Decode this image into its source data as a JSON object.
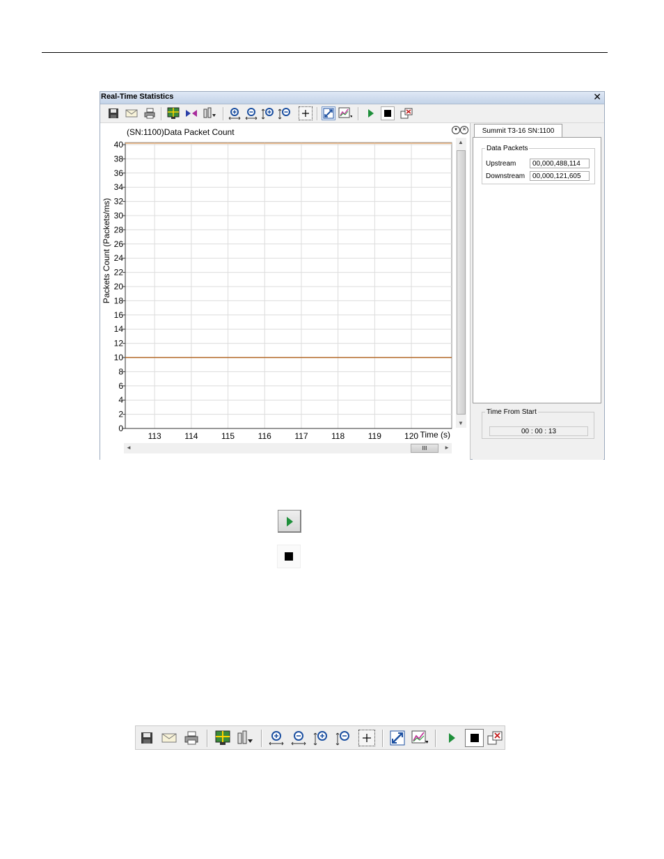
{
  "window": {
    "title": "Real-Time Statistics",
    "close_glyph": "✕"
  },
  "toolbar": {
    "buttons": [
      {
        "name": "save-icon"
      },
      {
        "name": "email-icon"
      },
      {
        "name": "print-icon"
      },
      {
        "name": "chart-grid-icon"
      },
      {
        "name": "compare-icon"
      },
      {
        "name": "properties-icon"
      },
      {
        "name": "zoom-in-horizontal-icon"
      },
      {
        "name": "zoom-out-horizontal-icon"
      },
      {
        "name": "zoom-in-vertical-icon"
      },
      {
        "name": "zoom-out-vertical-icon"
      },
      {
        "name": "zoom-box-icon"
      },
      {
        "name": "autoscale-icon"
      },
      {
        "name": "chart-options-icon"
      },
      {
        "name": "play-icon"
      },
      {
        "name": "stop-icon"
      },
      {
        "name": "detach-icon"
      }
    ]
  },
  "chart_data": {
    "type": "line",
    "title": "(SN:1100)Data Packet Count",
    "xlabel": "Time (s)",
    "ylabel": "Packets Count (Packets/ms)",
    "x_ticks": [
      113,
      114,
      115,
      116,
      117,
      118,
      119,
      120
    ],
    "y_ticks": [
      0,
      2,
      4,
      6,
      8,
      10,
      12,
      14,
      16,
      18,
      20,
      22,
      24,
      26,
      28,
      30,
      32,
      34,
      36,
      38,
      40
    ],
    "xlim": [
      112.2,
      121.1
    ],
    "ylim": [
      0,
      40
    ],
    "grid": true,
    "series": [
      {
        "color": "#e8b07a",
        "x": [
          112.2,
          121.1
        ],
        "y": [
          40.5,
          40.5
        ]
      },
      {
        "color": "#b36a2a",
        "x": [
          112.2,
          121.1
        ],
        "y": [
          10,
          10
        ]
      }
    ]
  },
  "side_panel": {
    "tab_label": "Summit T3-16 SN:1100",
    "group_title": "Data Packets",
    "upstream_label": "Upstream",
    "upstream_value": "00,000,488,114",
    "downstream_label": "Downstream",
    "downstream_value": "00,000,121,605",
    "time_group_title": "Time From Start",
    "time_value": "00 : 00 : 13"
  },
  "toolbar2": {
    "buttons": [
      {
        "name": "save-icon"
      },
      {
        "name": "email-icon"
      },
      {
        "name": "print-icon"
      },
      {
        "name": "chart-grid-icon"
      },
      {
        "name": "properties-icon"
      },
      {
        "name": "zoom-in-horizontal-icon"
      },
      {
        "name": "zoom-out-horizontal-icon"
      },
      {
        "name": "zoom-in-vertical-icon"
      },
      {
        "name": "zoom-out-vertical-icon"
      },
      {
        "name": "zoom-box-icon"
      },
      {
        "name": "autoscale-icon"
      },
      {
        "name": "chart-options-icon"
      },
      {
        "name": "play-icon"
      },
      {
        "name": "stop-icon"
      },
      {
        "name": "detach-icon"
      }
    ]
  },
  "colors": {
    "accent_green": "#1e8f3a",
    "title_bar": "#c3d3e8"
  }
}
